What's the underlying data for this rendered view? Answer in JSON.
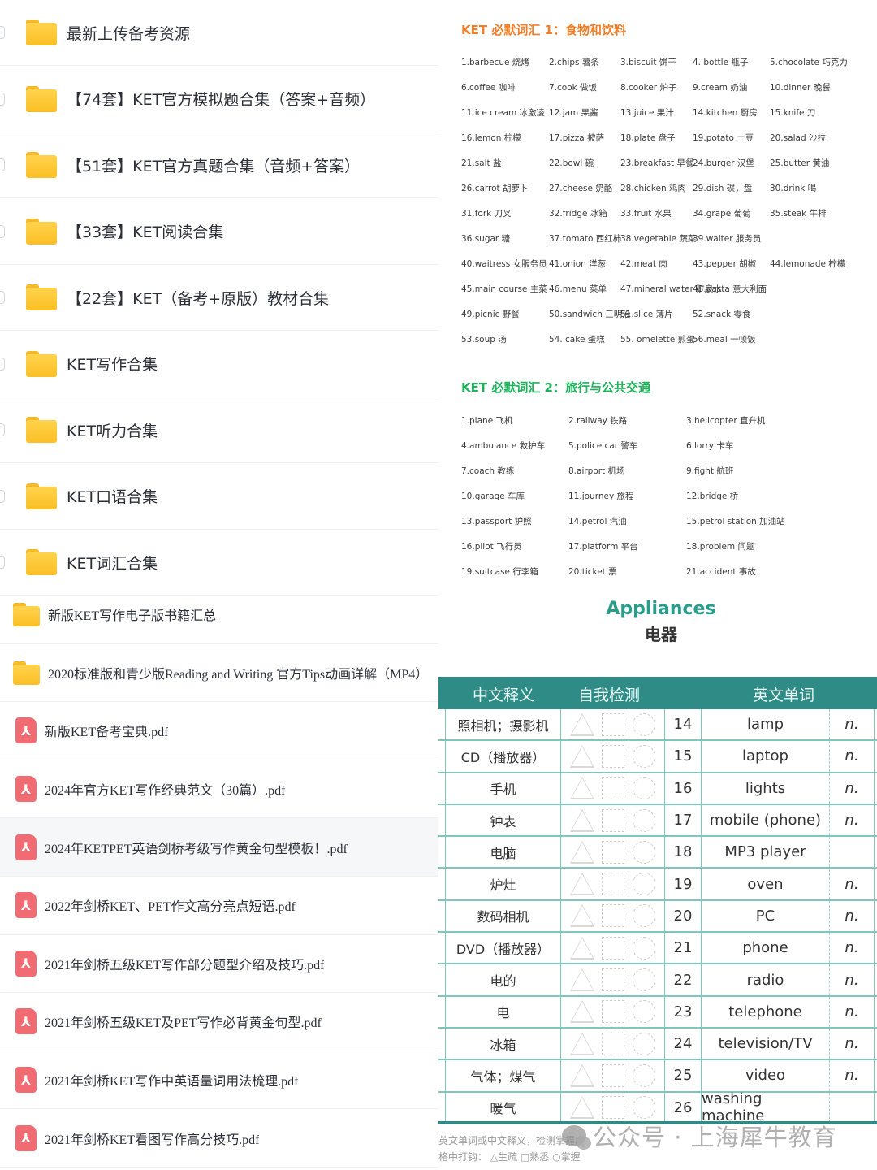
{
  "file_list": {
    "folders_large": [
      {
        "name": "最新上传备考资源"
      },
      {
        "name": "【74套】KET官方模拟题合集（答案+音频）"
      },
      {
        "name": "【51套】KET官方真题合集（音频+答案）"
      },
      {
        "name": "【33套】KET阅读合集"
      },
      {
        "name": "【22套】KET（备考+原版）教材合集"
      },
      {
        "name": "KET写作合集"
      },
      {
        "name": "KET听力合集"
      },
      {
        "name": "KET口语合集"
      },
      {
        "name": "KET词汇合集"
      }
    ],
    "folders_small": [
      {
        "name": "新版KET写作电子版书籍汇总"
      },
      {
        "name": "2020标准版和青少版Reading and Writing 官方Tips动画详解（MP4）"
      }
    ],
    "pdfs": [
      {
        "name": "新版KET备考宝典.pdf"
      },
      {
        "name": "2024年官方KET写作经典范文（30篇）.pdf"
      },
      {
        "name": "2024年KETPET英语剑桥考级写作黄金句型模板！.pdf"
      },
      {
        "name": "2022年剑桥KET、PET作文高分亮点短语.pdf"
      },
      {
        "name": "2021年剑桥五级KET写作部分题型介绍及技巧.pdf"
      },
      {
        "name": "2021年剑桥五级KET及PET写作必背黄金句型.pdf"
      },
      {
        "name": "2021年剑桥KET写作中英语量词用法梳理.pdf"
      },
      {
        "name": "2021年剑桥KET看图写作高分技巧.pdf"
      }
    ],
    "pdf_icon_glyph": "⅄"
  },
  "vocab1": {
    "title": "KET 必默词汇  1：食物和饮料",
    "color": "#f07f2a",
    "rows": [
      [
        "1.barbecue  烧烤",
        "2.chips 薯条",
        "3.biscuit 饼干",
        "4. bottle 瓶子",
        "5.chocolate 巧克力"
      ],
      [
        "6.coffee  咖啡",
        "7.cook 做饭",
        "8.cooker 炉子",
        "9.cream 奶油",
        "10.dinner 晚餐"
      ],
      [
        "11.ice cream  冰激凌",
        "12.jam 果酱",
        "13.juice 果汁",
        "14.kitchen 厨房",
        "15.knife 刀"
      ],
      [
        "16.lemon  柠檬",
        "17.pizza 披萨",
        "18.plate 盘子",
        "19.potato 土豆",
        "20.salad 沙拉"
      ],
      [
        "21.salt  盐",
        "22.bowl 碗",
        "23.breakfast 早餐",
        "24.burger 汉堡",
        "25.butter 黄油"
      ],
      [
        "26.carrot  胡萝卜",
        "27.cheese 奶酪",
        "28.chicken 鸡肉",
        "29.dish 碟，盘",
        "30.drink 喝"
      ],
      [
        "31.fork 刀叉",
        "32.fridge 冰箱",
        "33.fruit 水果",
        "34.grape 葡萄",
        "35.steak 牛排"
      ],
      [
        "36.sugar 糖",
        "37.tomato 西红柿",
        "38.vegetable  蔬菜",
        "39.waiter 服务员",
        ""
      ],
      [
        "40.waitress  女服务员",
        "41.onion  洋葱",
        "42.meat  肉",
        "43.pepper  胡椒",
        "44.lemonade 柠檬"
      ],
      [
        "45.main course  主菜",
        "46.menu  菜单",
        "47.mineral water 矿泉水",
        "48.pasta 意大利面",
        ""
      ],
      [
        "49.picnic 野餐",
        "50.sandwich  三明治",
        "51.slice 薄片",
        "52.snack 零食",
        ""
      ],
      [
        "53.soup 汤",
        "54. cake  蛋糕",
        "55. omelette 煎蛋",
        "56.meal 一顿饭",
        ""
      ]
    ]
  },
  "vocab2": {
    "title": "KET 必默词汇  2：旅行与公共交通",
    "color": "#1db35a",
    "rows": [
      [
        "1.plane 飞机",
        "2.railway 铁路",
        "3.helicopter 直升机"
      ],
      [
        "4.ambulance 救护车",
        "5.police car 警车",
        "6.lorry 卡车"
      ],
      [
        "7.coach 教练",
        "8.airport 机场",
        "9.fight 航班"
      ],
      [
        "10.garage 车库",
        "11.journey 旅程",
        "12.bridge 桥"
      ],
      [
        "13.passport 护照",
        "14.petrol 汽油",
        "15.petrol station 加油站"
      ],
      [
        "16.pilot 飞行员",
        "17.platform 平台",
        "18.problem 问题"
      ],
      [
        "19.suitcase 行李箱",
        "20.ticket 票",
        "21.accident 事故"
      ]
    ]
  },
  "appliances": {
    "title_en": "Appliances",
    "title_cn": "电器",
    "accent": "#2e8b85",
    "headers": {
      "cn": "中文释义",
      "check": "自我检测",
      "en": "英文单词"
    },
    "rows": [
      {
        "cn": "照相机；摄影机",
        "num": "14",
        "en": "lamp",
        "pos": "n."
      },
      {
        "cn": "CD（播放器）",
        "num": "15",
        "en": "laptop",
        "pos": "n."
      },
      {
        "cn": "手机",
        "num": "16",
        "en": "lights",
        "pos": "n."
      },
      {
        "cn": "钟表",
        "num": "17",
        "en": "mobile (phone)",
        "pos": "n."
      },
      {
        "cn": "电脑",
        "num": "18",
        "en": "MP3 player",
        "pos": ""
      },
      {
        "cn": "炉灶",
        "num": "19",
        "en": "oven",
        "pos": "n."
      },
      {
        "cn": "数码相机",
        "num": "20",
        "en": "PC",
        "pos": "n."
      },
      {
        "cn": "DVD（播放器）",
        "num": "21",
        "en": "phone",
        "pos": "n."
      },
      {
        "cn": "电的",
        "num": "22",
        "en": "radio",
        "pos": "n."
      },
      {
        "cn": "电",
        "num": "23",
        "en": "telephone",
        "pos": "n."
      },
      {
        "cn": "冰箱",
        "num": "24",
        "en": "television/TV",
        "pos": "n."
      },
      {
        "cn": "气体；煤气",
        "num": "25",
        "en": "video",
        "pos": "n."
      },
      {
        "cn": "暖气",
        "num": "26",
        "en": "washing machine",
        "pos": ""
      }
    ],
    "legend_line1": "英文单词或中文释义，检测掌握度",
    "legend_line2": "格中打钩：",
    "legend_items": [
      "生疏",
      "熟悉",
      "掌握"
    ]
  },
  "watermark": "公众号 · 上海犀牛教育"
}
